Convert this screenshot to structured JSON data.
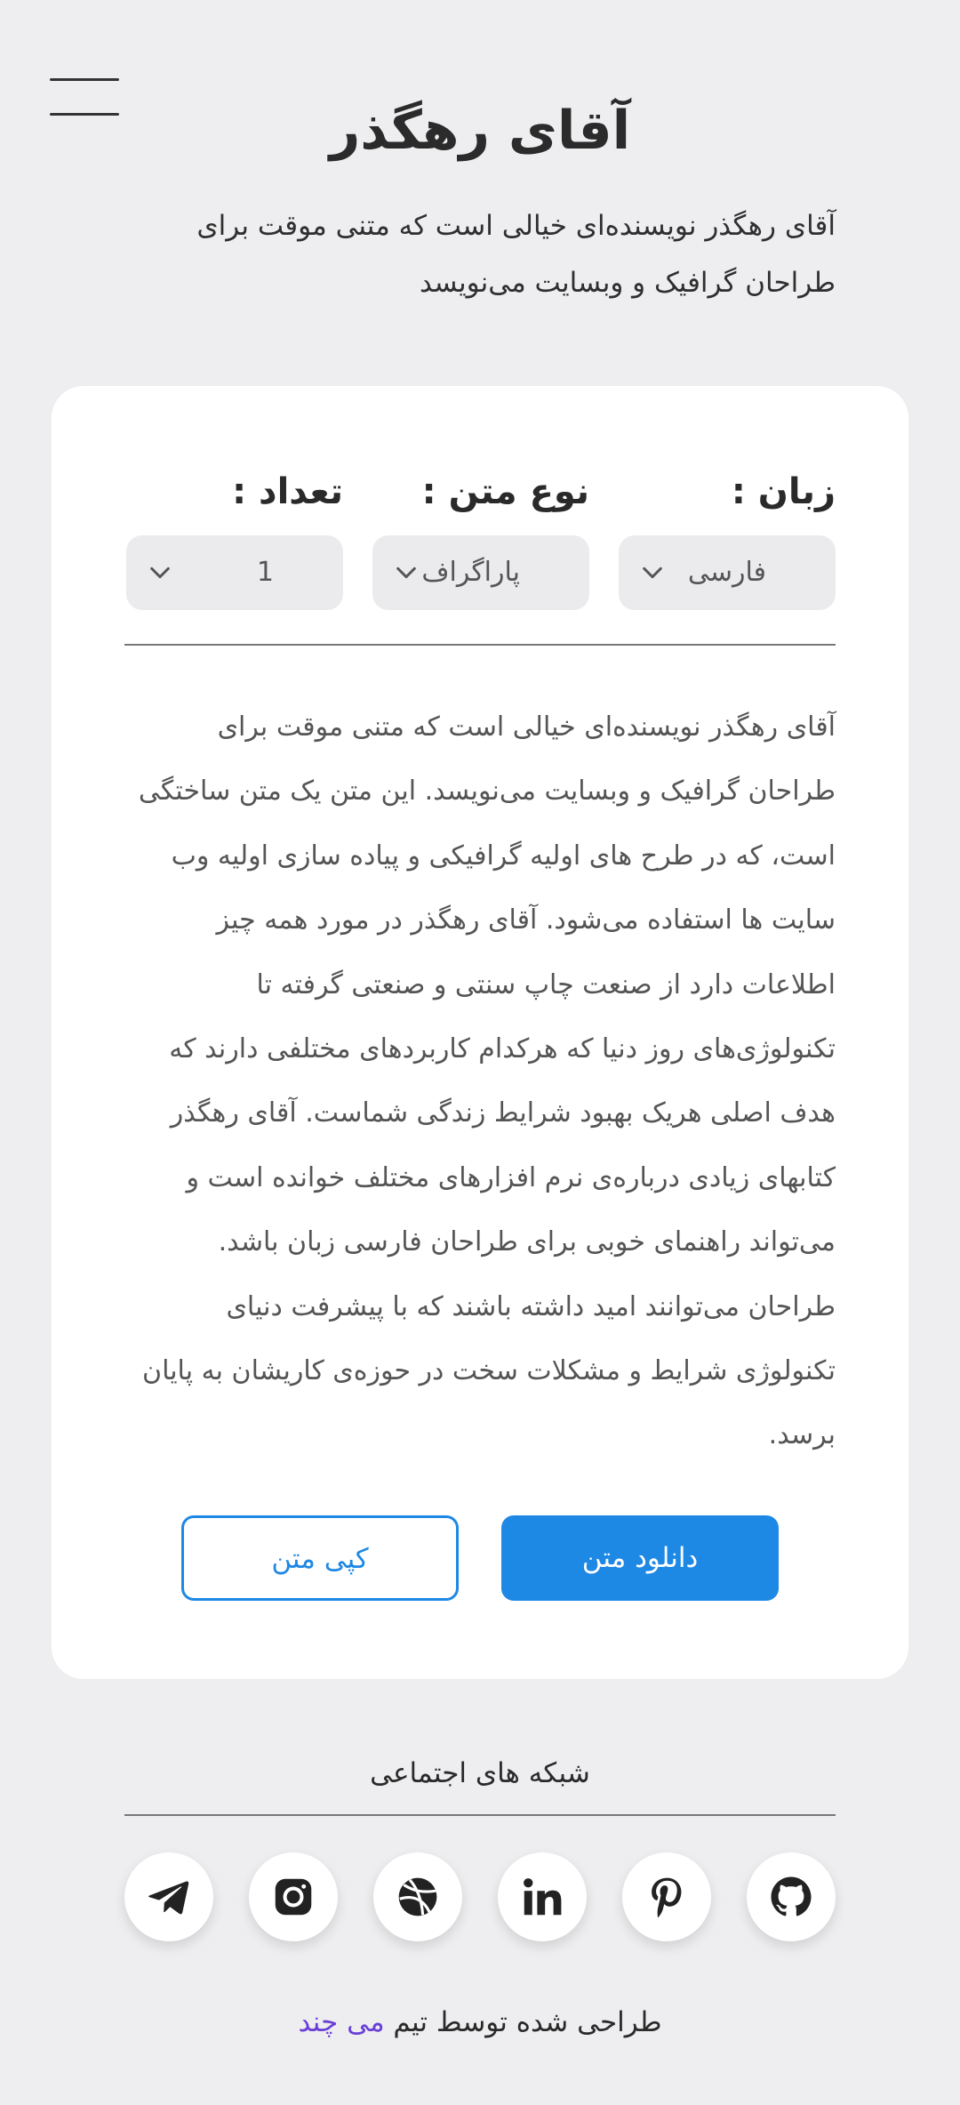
{
  "header": {
    "title": "آقای رهگذر",
    "intro": "آقای رهگذر نویسنده‌ای خیالی است که متنی موقت برای طراحان گرافیک و وبسایت می‌نویسد"
  },
  "form": {
    "language": {
      "label": "زبان :",
      "value": "فارسی"
    },
    "text_type": {
      "label": "نوع متن :",
      "value": "پاراگراف"
    },
    "count": {
      "label": "تعداد :",
      "value": "1"
    }
  },
  "generated_text": "آقای رهگذر نویسنده‌ای خیالی است که متنی موقت برای طراحان گرافیک و وبسایت می‌نویسد. این متن یک متن ساختگی است، که در طرح های اولیه گرافیکی و پیاده سازی اولیه وب سایت ها استفاده می‌شود. آقای رهگذر در مورد همه چیز اطلاعات دارد از صنعت چاپ سنتی و صنعتی گرفته تا تکنولوژی‌های روز دنیا که هرکدام کاربردهای مختلفی دارند که هدف اصلی هریک بهبود شرایط زندگی شماست. آقای رهگذر کتابهای زیادی درباره‌ی نرم افزارهای مختلف خوانده است و می‌تواند راهنمای خوبی برای طراحان فارسی زبان باشد. طراحان می‌توانند امید داشته باشند که با پیشرفت دنیای تکنولوژی شرایط و مشکلات سخت در حوزه‌ی کاریشان به پایان برسد.",
  "actions": {
    "download": "دانلود متن",
    "copy": "کپی متن"
  },
  "social": {
    "title": "شبکه های اجتماعی",
    "icons": [
      "github-icon",
      "pinterest-icon",
      "linkedin-icon",
      "dribbble-icon",
      "instagram-icon",
      "telegram-icon"
    ]
  },
  "footer": {
    "credit_prefix": "طراحی شده توسط تیم",
    "team_name": "می چند"
  },
  "colors": {
    "accent": "#1e88e5",
    "team": "#6a3fd6",
    "background": "#eeeef0"
  }
}
